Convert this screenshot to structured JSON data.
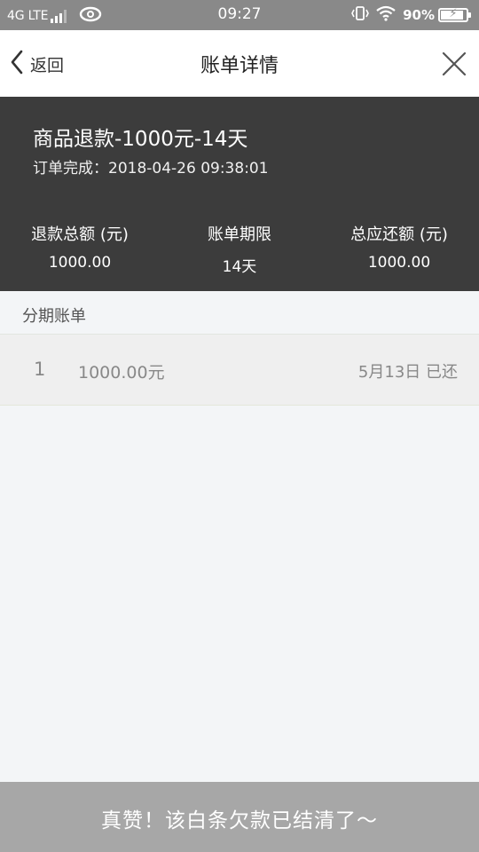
{
  "status_bar": {
    "network": "4G LTE",
    "time": "09:27",
    "battery_percent": "90%",
    "battery_level": 0.9,
    "icons": [
      "signal-icon",
      "hd-icon",
      "vibrate-icon",
      "wifi-icon",
      "battery-icon"
    ]
  },
  "nav": {
    "back_label": "返回",
    "title": "账单详情"
  },
  "summary": {
    "product_title": "商品退款-1000元-14天",
    "order_complete": "订单完成：2018-04-26 09:38:01",
    "stats": [
      {
        "label": "退款总额 (元)",
        "value": "1000.00"
      },
      {
        "label": "账单期限",
        "value": "14天"
      },
      {
        "label": "总应还额 (元)",
        "value": "1000.00"
      }
    ]
  },
  "installments": {
    "header": "分期账单",
    "rows": [
      {
        "index": "1",
        "amount": "1000.00元",
        "status": "5月13日 已还"
      }
    ]
  },
  "banner": {
    "text": "真赞！该白条欠款已结清了～"
  },
  "colors": {
    "status_bar_bg": "#898989",
    "summary_bg": "#3c3c3c",
    "page_bg": "#f3f5f7",
    "banner_bg": "#a7a7a7"
  }
}
